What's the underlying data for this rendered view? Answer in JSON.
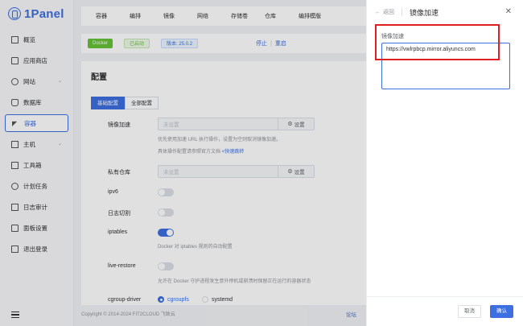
{
  "app": {
    "logo_text": "1Panel",
    "accent": "#3d6fe0",
    "highlight_color": "#e02020"
  },
  "sidebar": {
    "items": [
      {
        "label": "概览",
        "icon": "home-icon"
      },
      {
        "label": "应用商店",
        "icon": "store-icon"
      },
      {
        "label": "网站",
        "icon": "globe-icon"
      },
      {
        "label": "数据库",
        "icon": "database-icon"
      },
      {
        "label": "容器",
        "icon": "docker-icon",
        "active": true
      },
      {
        "label": "主机",
        "icon": "host-icon"
      },
      {
        "label": "工具箱",
        "icon": "toolbox-icon"
      },
      {
        "label": "计划任务",
        "icon": "calendar-icon"
      },
      {
        "label": "日志审计",
        "icon": "log-icon"
      },
      {
        "label": "面板设置",
        "icon": "settings-icon"
      },
      {
        "label": "退出登录",
        "icon": "logout-icon"
      }
    ]
  },
  "topbar": {
    "tabs": [
      "容器",
      "编排",
      "镜像",
      "网络",
      "存储卷",
      "仓库",
      "编排模版"
    ]
  },
  "status": {
    "docker": "Docker",
    "running": "已启动",
    "version": "版本: 25.0.2",
    "stop": "停止",
    "restart": "重启"
  },
  "config": {
    "title": "配置",
    "seg": {
      "basic": "基础配置",
      "all": "全部配置"
    },
    "mirror": {
      "label": "镜像加速",
      "placeholder": "未设置",
      "action": "设置",
      "help1": "优先使用加速 URL 执行操作，设置为空则取消镜像加速。",
      "help2": "具体操作配置请参照官方文档",
      "help_link": "<快速跳转"
    },
    "registry": {
      "label": "私有仓库",
      "placeholder": "未设置",
      "action": "设置"
    },
    "ipv6": {
      "label": "ipv6",
      "on": false
    },
    "log_cut": {
      "label": "日志切割",
      "on": false
    },
    "iptables": {
      "label": "iptables",
      "on": true,
      "help": "Docker 对 iptables 规则的自动配置"
    },
    "live_restore": {
      "label": "live-restore",
      "on": false,
      "help": "允许在 Docker 守护进程发生意外停机或崩溃时保留正在运行的容器状态"
    },
    "cgroup": {
      "label": "cgroup-driver",
      "opt1": "cgroupfs",
      "opt2": "systemd",
      "selected": "cgroupfs"
    }
  },
  "footer": {
    "copyright": "Copyright © 2014-2024 FIT2CLOUD 飞致云",
    "link": "论坛"
  },
  "drawer": {
    "back": "返回",
    "title": "镜像加速",
    "field_label": "镜像加速",
    "field_value": "https://vwlrpbcp.mirror.aliyuncs.com",
    "cancel": "取消",
    "confirm": "确认"
  }
}
